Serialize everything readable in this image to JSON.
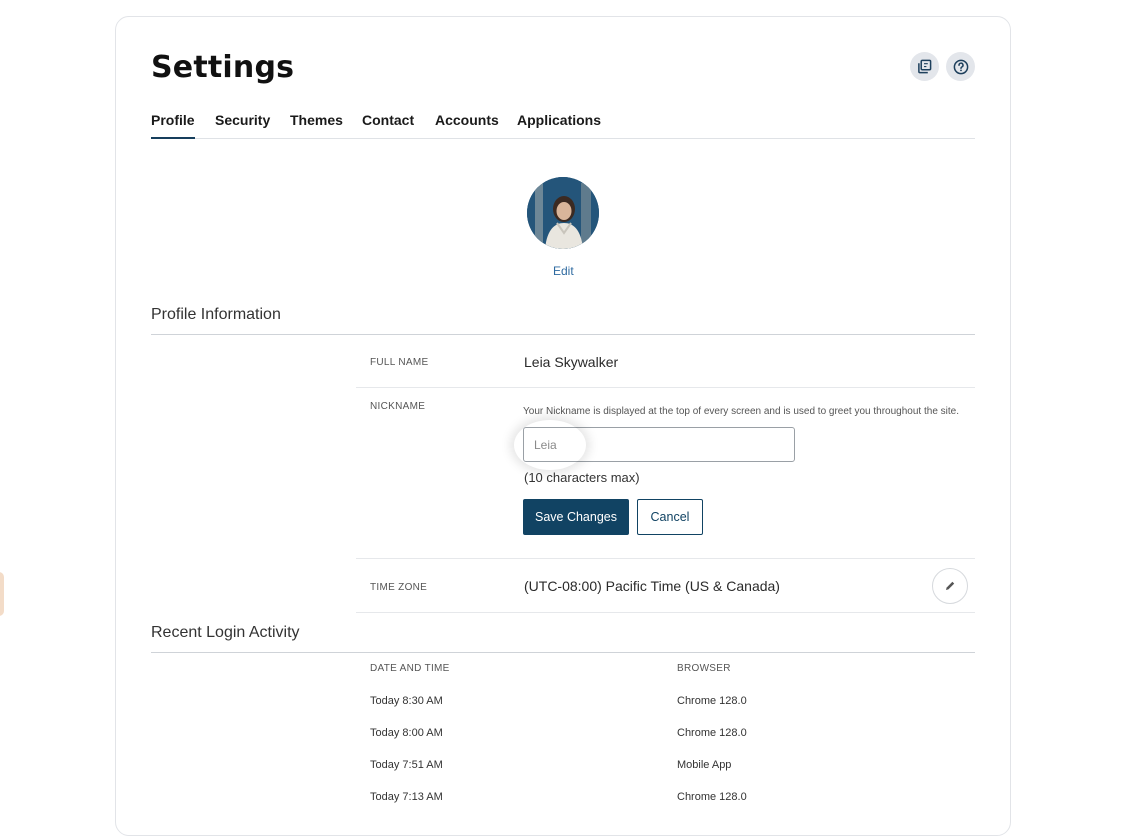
{
  "header": {
    "title": "Settings",
    "icons": [
      "copy-icon",
      "help-icon"
    ]
  },
  "tabs": [
    {
      "label": "Profile",
      "active": true
    },
    {
      "label": "Security",
      "active": false
    },
    {
      "label": "Themes",
      "active": false
    },
    {
      "label": "Contact",
      "active": false
    },
    {
      "label": "Accounts",
      "active": false
    },
    {
      "label": "Applications",
      "active": false
    }
  ],
  "avatar": {
    "edit_label": "Edit"
  },
  "profile_info": {
    "title": "Profile Information",
    "full_name_label": "FULL NAME",
    "full_name_value": "Leia Skywalker",
    "nickname_label": "NICKNAME",
    "nickname_help": "Your Nickname is displayed at the top of every screen and is used to greet you throughout the site.",
    "nickname_placeholder": "Leia",
    "nickname_hint": "(10 characters max)",
    "save_label": "Save Changes",
    "cancel_label": "Cancel",
    "timezone_label": "TIME ZONE",
    "timezone_value": "(UTC-08:00) Pacific Time (US & Canada)"
  },
  "login_activity": {
    "title": "Recent Login Activity",
    "columns": [
      "DATE AND TIME",
      "BROWSER"
    ],
    "rows": [
      {
        "datetime": "Today 8:30 AM",
        "browser": "Chrome 128.0"
      },
      {
        "datetime": "Today 8:00 AM",
        "browser": "Chrome 128.0"
      },
      {
        "datetime": "Today 7:51 AM",
        "browser": "Mobile App"
      },
      {
        "datetime": "Today 7:13 AM",
        "browser": "Chrome 128.0"
      }
    ]
  },
  "colors": {
    "primary": "#114363",
    "link": "#2e6aa0",
    "tab_underline": "#163e5c"
  }
}
